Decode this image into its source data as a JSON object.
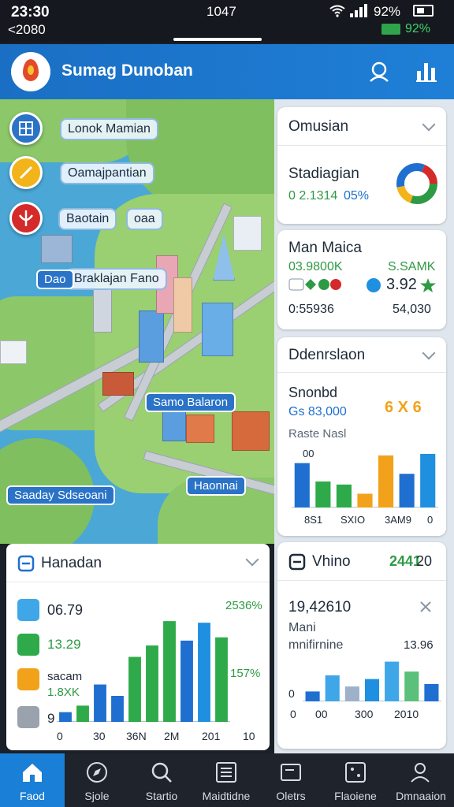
{
  "status": {
    "time": "23:30",
    "sub": "<2080",
    "center": "1047",
    "battery_pct": "92%",
    "charge_pct": "92%"
  },
  "header": {
    "title": "Sumag Dunoban"
  },
  "map": {
    "labels": [
      "Lonok Mamian",
      "Oamajpantian",
      "Baotain",
      "oaa",
      "Braklajan Fano",
      "Dao"
    ],
    "chips": [
      "Samo Balaron",
      "Saaday Sdseoani",
      "Haonnai"
    ]
  },
  "card_musian": {
    "title": "Omusian",
    "label": "Stadiagian",
    "value": "0 2.1314",
    "pct": "05%"
  },
  "card_man": {
    "title": "Man Maica",
    "left_val": "03.9800K",
    "right_val": "S.SAMK",
    "stat": "3.92",
    "foot_left": "0:55936",
    "foot_right": "54,030"
  },
  "card_dden": {
    "title": "Ddenrslaon",
    "subtitle": "Snonbd",
    "amount": "Gs 83,000",
    "badge": "6 X 6",
    "note": "Raste Nasl",
    "top_label": "00",
    "x_labels": [
      "8S1",
      "SXIO",
      "3AM9",
      "0"
    ]
  },
  "chart_dden": {
    "type": "bar",
    "values": [
      58,
      34,
      30,
      18,
      68,
      44,
      70
    ],
    "colors": [
      "#1f6fd0",
      "#2eaa4a",
      "#2eaa4a",
      "#f2a21a",
      "#f2a21a",
      "#1f6fd0",
      "#1f8fe0"
    ]
  },
  "card_vhino": {
    "title": "Vhino",
    "badge": "2441",
    "badge2": "20",
    "value": "19,42610",
    "sub1": "Mani",
    "sub2": "mnifirnine",
    "sub_right": "13.96",
    "y_label": "0",
    "x_labels": [
      "0",
      "00",
      "300",
      "2010"
    ]
  },
  "chart_vhino": {
    "type": "bar",
    "values": [
      16,
      42,
      24,
      36,
      64,
      48,
      28
    ],
    "colors": [
      "#1f6fd0",
      "#3fa6e8",
      "#9db1c8",
      "#1f8fe0",
      "#3fa6e8",
      "#5ac07a",
      "#1f6fd0"
    ]
  },
  "card_handadn": {
    "title": "Hanadan",
    "rows": [
      "06.79",
      "13.29",
      "sacam",
      "1.8XK",
      "9"
    ],
    "right_top": "2536%",
    "right_mid": "157%",
    "x_labels": [
      "0",
      "30",
      "36N",
      "2M",
      "201",
      "10"
    ]
  },
  "chart_handadn": {
    "type": "bar",
    "values": [
      12,
      20,
      46,
      32,
      80,
      94,
      124,
      100,
      122,
      104
    ],
    "colors": [
      "#1f6fd0",
      "#2eaa4a",
      "#1f6fd0",
      "#1f6fd0",
      "#2eaa4a",
      "#2eaa4a",
      "#2eaa4a",
      "#1f6fd0",
      "#1f8fe0",
      "#2eaa4a"
    ]
  },
  "nav": {
    "items": [
      "Faod",
      "Sjole",
      "Startio",
      "Maidtidne",
      "Oletrs",
      "Flaoiene",
      "Dmnaaion"
    ]
  }
}
